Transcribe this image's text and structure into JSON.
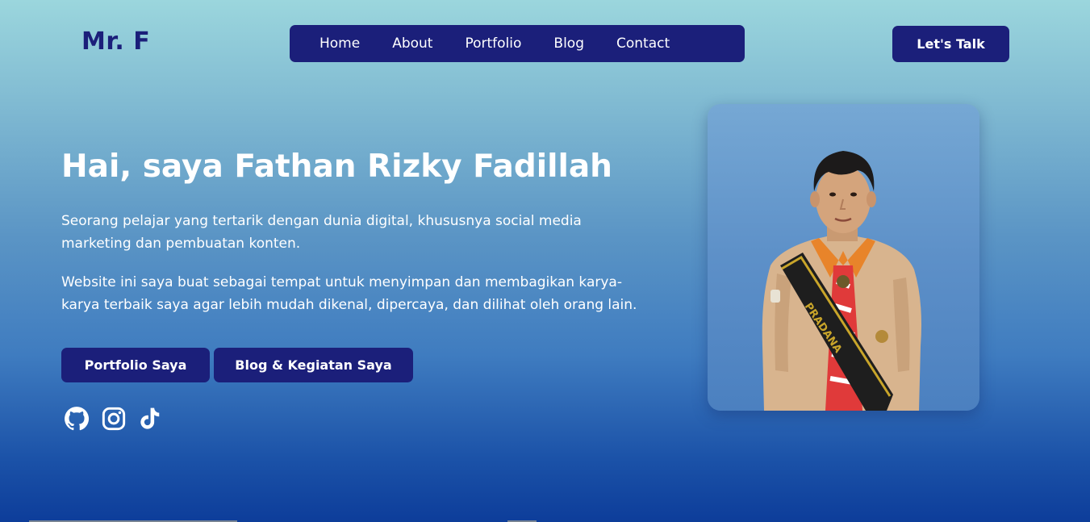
{
  "brand": {
    "logo": "Mr. F"
  },
  "nav": {
    "items": [
      {
        "label": "Home"
      },
      {
        "label": "About"
      },
      {
        "label": "Portfolio"
      },
      {
        "label": "Blog"
      },
      {
        "label": "Contact"
      }
    ],
    "cta_label": "Let's Talk"
  },
  "hero": {
    "title": "Hai, saya Fathan Rizky Fadillah",
    "paragraph_1": "Seorang pelajar yang tertarik dengan dunia digital, khususnya social media marketing dan pembuatan konten.",
    "paragraph_2": "Website ini saya buat sebagai tempat untuk menyimpan dan membagikan karya-karya terbaik saya agar lebih mudah dikenal, dipercaya, dan dilihat oleh orang lain.",
    "buttons": {
      "portfolio": "Portfolio Saya",
      "blog": "Blog & Kegiatan Saya"
    }
  },
  "social": [
    {
      "icon": "github-icon"
    },
    {
      "icon": "instagram-icon"
    },
    {
      "icon": "tiktok-icon"
    }
  ],
  "photo": {
    "sash_text": "PRADANA",
    "description_icon": "profile-photo"
  },
  "colors": {
    "primary": "#1b1f7a",
    "text": "#ffffff",
    "gradient_top": "#9bd6dd",
    "gradient_bottom": "#0d3d9a"
  }
}
